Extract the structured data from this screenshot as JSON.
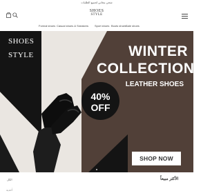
{
  "announcement": {
    "text": "شحن مجاني لجميع الطلبات"
  },
  "header": {
    "logo_line1": "SHOES",
    "logo_line2": "STYLE",
    "bag_icon": "shopping-bag-icon",
    "search_icon": "search-icon",
    "menu_icon": "hamburger-menu-icon"
  },
  "nav": {
    "items": [
      {
        "label": "Sale shoes"
      },
      {
        "label": "Boots shoes"
      },
      {
        "label": "Sport shoes"
      },
      {
        "label": "Casual shoes & Sneakers"
      },
      {
        "label": "Formal shoes"
      }
    ]
  },
  "hero": {
    "logo_line1": "SHOES",
    "logo_line2": "STYLE",
    "title_line1": "WINTER",
    "title_line2": "COLLECTION",
    "subtitle": "LEATHER SHOES",
    "badge_line1": "40%",
    "badge_line2": "OFF",
    "cta": "SHOP NOW",
    "colors": {
      "background": "#514038",
      "beige": "#eae6e1",
      "dark": "#141414"
    }
  },
  "below": {
    "left_link": "الكل",
    "right_heading": "الأكثر مبيعاً",
    "section_label": "أحذية"
  }
}
